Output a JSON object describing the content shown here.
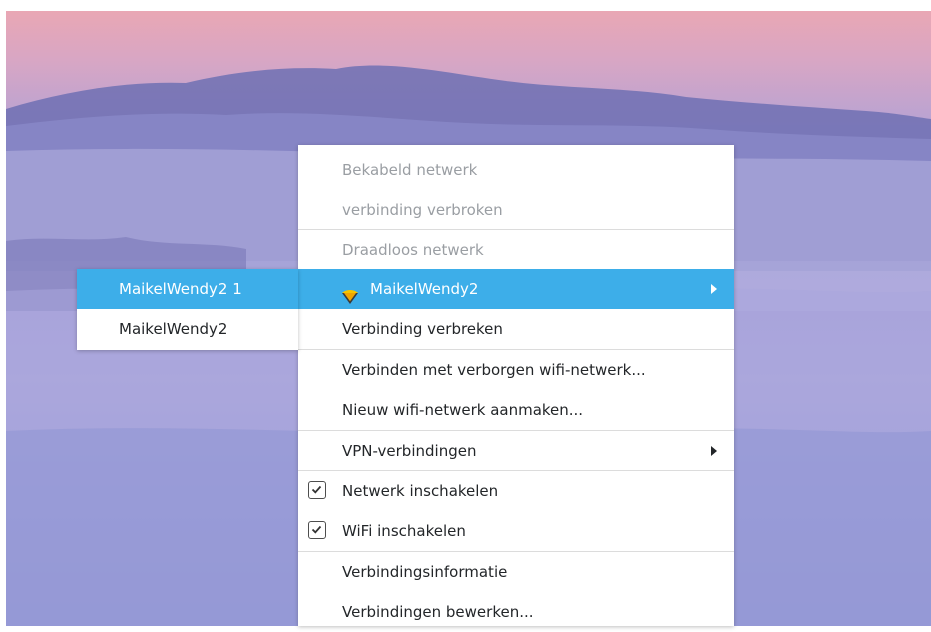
{
  "main_menu": {
    "wired_header": "Bekabeld netwerk",
    "wired_status": "verbinding verbroken",
    "wireless_header": "Draadloos netwerk",
    "active_network": "MaikelWendy2",
    "disconnect": "Verbinding verbreken",
    "connect_hidden": "Verbinden met verborgen wifi-netwerk...",
    "new_network": "Nieuw wifi-netwerk aanmaken...",
    "vpn": "VPN-verbindingen",
    "enable_network": "Netwerk inschakelen",
    "enable_network_checked": true,
    "enable_wifi": "WiFi inschakelen",
    "enable_wifi_checked": true,
    "connection_info": "Verbindingsinformatie",
    "edit_connections": "Verbindingen bewerken..."
  },
  "submenu": {
    "items": [
      "MaikelWendy2 1",
      "MaikelWendy2"
    ],
    "highlighted_index": 0
  },
  "icons": {
    "network": "wifi-signal-icon",
    "submenu_arrow": "chevron-right-icon",
    "checkbox": "checkbox-checked-icon"
  },
  "colors": {
    "highlight": "#3daee9",
    "text": "#232629",
    "disabled_text": "#9a9ea3"
  }
}
